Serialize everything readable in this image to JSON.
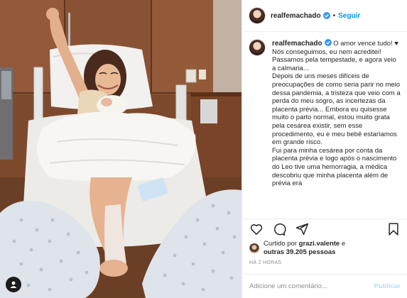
{
  "header": {
    "username": "realfemachado",
    "separator": "•",
    "follow_label": "Seguir"
  },
  "caption": {
    "username": "realfemachado",
    "text": "O amor vence tudo! ♥\nNós conseguimos, eu nem acreditei! Passamos pela tempestade, e agora veio a calmaria...\nDepois de uns meses difíceis de preocupações de como seria parir no meio dessa pandemia, a tristeza que veio com a perda do meu sogro, as incertezas da placenta prévia... Embora eu quisesse muito o parto normal, estou muito grata pela cesárea existir, sem esse procedimento, eu e meu bebê estaríamos em grande risco.\nFui para minha cesárea por conta da placenta prévia e logo após o nascimento do Leo tive uma hemorragia, a médica descobriu que minha placenta além de prévia era"
  },
  "actions": {
    "like": "heart-icon",
    "comment": "comment-icon",
    "share": "share-icon",
    "save": "bookmark-icon"
  },
  "likes": {
    "prefix": "Curtido por ",
    "user": "grazi.valente",
    "middle": " e",
    "others": "outras 39.205 pessoas"
  },
  "timestamp": "HÁ 2 HORAS",
  "comment": {
    "placeholder": "Adicione um comentário...",
    "publish_label": "Publicar"
  },
  "colors": {
    "accent": "#0095f6",
    "publish_disabled": "#b2dffc",
    "muted": "#8e8e8e",
    "verified": "#3897f0"
  }
}
